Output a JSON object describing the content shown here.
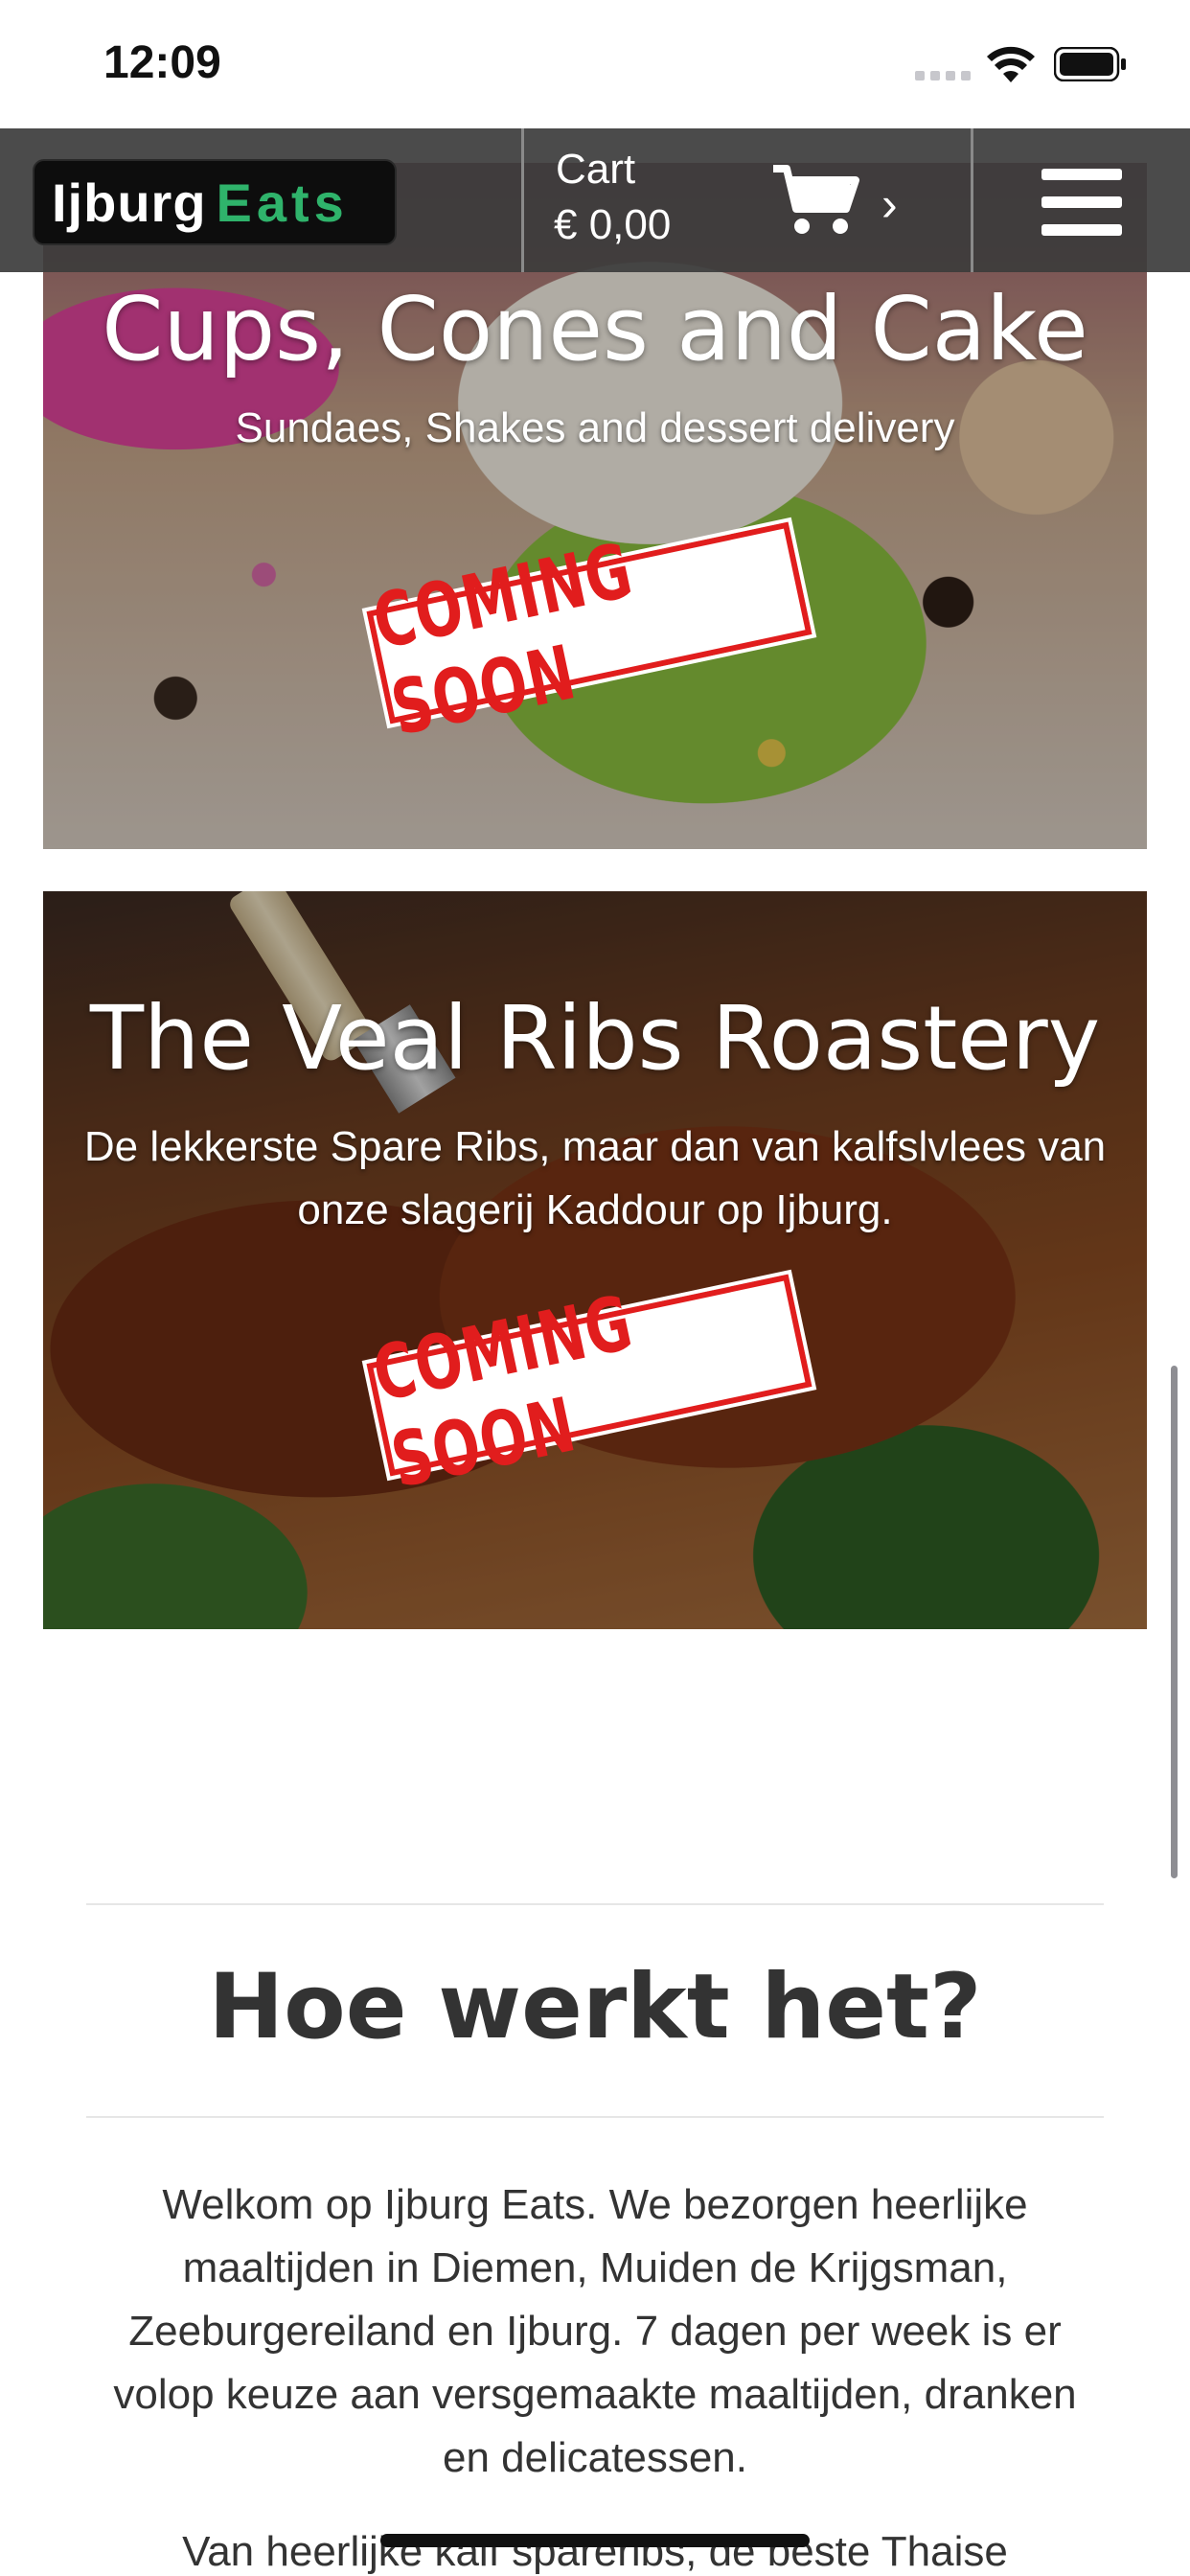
{
  "status_bar": {
    "time": "12:09"
  },
  "header": {
    "logo_part1": "Ijburg",
    "logo_part2": "Eats",
    "cart_label": "Cart",
    "cart_amount": "€ 0,00",
    "cart_chevron": "›",
    "icons": [
      "shopping-cart-icon",
      "hamburger-menu-icon"
    ]
  },
  "restaurants": [
    {
      "title": "Cups, Cones and Cake",
      "subtitle": "Sundaes, Shakes and dessert delivery",
      "badge": "COMING SOON"
    },
    {
      "title": "The Veal Ribs Roastery",
      "subtitle": "De lekkerste Spare Ribs, maar dan van kalfslvlees van onze slagerij Kaddour op Ijburg.",
      "badge": "COMING SOON"
    }
  ],
  "how_it_works": {
    "heading": "Hoe werkt het?",
    "paragraph1": "Welkom op Ijburg Eats. We bezorgen heerlijke maaltijden in Diemen, Muiden de Krijgsman, Zeeburgereiland en Ijburg. 7 dagen per week is er volop keuze aan versgemaakte maaltijden, dranken en delicatessen.",
    "paragraph2": "Van heerlijke kalf spareribs, de beste Thaise"
  },
  "colors": {
    "logo_accent": "#2fb36b",
    "header_bg": "#3c3c3c",
    "stamp_red": "#e11d1d"
  }
}
